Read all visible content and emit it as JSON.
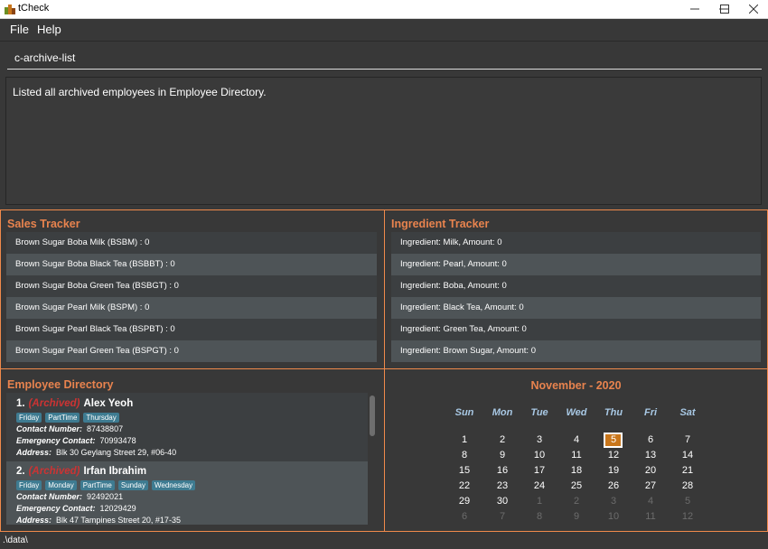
{
  "window": {
    "title": "tCheck"
  },
  "menu": {
    "file": "File",
    "help": "Help"
  },
  "command": {
    "value": "c-archive-list"
  },
  "result": {
    "text": "Listed all archived employees in Employee Directory."
  },
  "sales": {
    "title": "Sales Tracker",
    "items": [
      "Brown Sugar Boba Milk (BSBM) : 0",
      "Brown Sugar Boba Black Tea (BSBBT) : 0",
      "Brown Sugar Boba Green Tea (BSBGT) : 0",
      "Brown Sugar Pearl Milk (BSPM) : 0",
      "Brown Sugar Pearl Black Tea (BSPBT) : 0",
      "Brown Sugar Pearl Green Tea (BSPGT) : 0"
    ]
  },
  "ingredients": {
    "title": "Ingredient Tracker",
    "items": [
      "Ingredient: Milk,  Amount: 0",
      "Ingredient: Pearl,  Amount: 0",
      "Ingredient: Boba,  Amount: 0",
      "Ingredient: Black Tea,  Amount: 0",
      "Ingredient: Green Tea,  Amount: 0",
      "Ingredient: Brown Sugar,  Amount: 0"
    ]
  },
  "employees": {
    "title": "Employee Directory",
    "contact_label": "Contact Number:",
    "emergency_label": "Emergency Contact:",
    "address_label": "Address:",
    "archived_label": "(Archived)",
    "list": [
      {
        "index": "1.",
        "name": "Alex Yeoh",
        "tags": [
          "Friday",
          "PartTime",
          "Thursday"
        ],
        "contact": "87438807",
        "emergency": "70993478",
        "address": "Blk 30 Geylang Street 29, #06-40"
      },
      {
        "index": "2.",
        "name": "Irfan Ibrahim",
        "tags": [
          "Friday",
          "Monday",
          "PartTime",
          "Sunday",
          "Wednesday"
        ],
        "contact": "92492021",
        "emergency": "12029429",
        "address": "Blk 47 Tampines Street 20, #17-35"
      }
    ]
  },
  "calendar": {
    "title": "November - 2020",
    "days_of_week": [
      "Sun",
      "Mon",
      "Tue",
      "Wed",
      "Thu",
      "Fri",
      "Sat"
    ],
    "weeks": [
      [
        "1",
        "2",
        "3",
        "4",
        "5",
        "6",
        "7"
      ],
      [
        "8",
        "9",
        "10",
        "11",
        "12",
        "13",
        "14"
      ],
      [
        "15",
        "16",
        "17",
        "18",
        "19",
        "20",
        "21"
      ],
      [
        "22",
        "23",
        "24",
        "25",
        "26",
        "27",
        "28"
      ],
      [
        "29",
        "30",
        "1",
        "2",
        "3",
        "4",
        "5"
      ],
      [
        "6",
        "7",
        "8",
        "9",
        "10",
        "11",
        "12"
      ]
    ],
    "today": "5"
  },
  "status": {
    "path": ".\\data\\"
  }
}
